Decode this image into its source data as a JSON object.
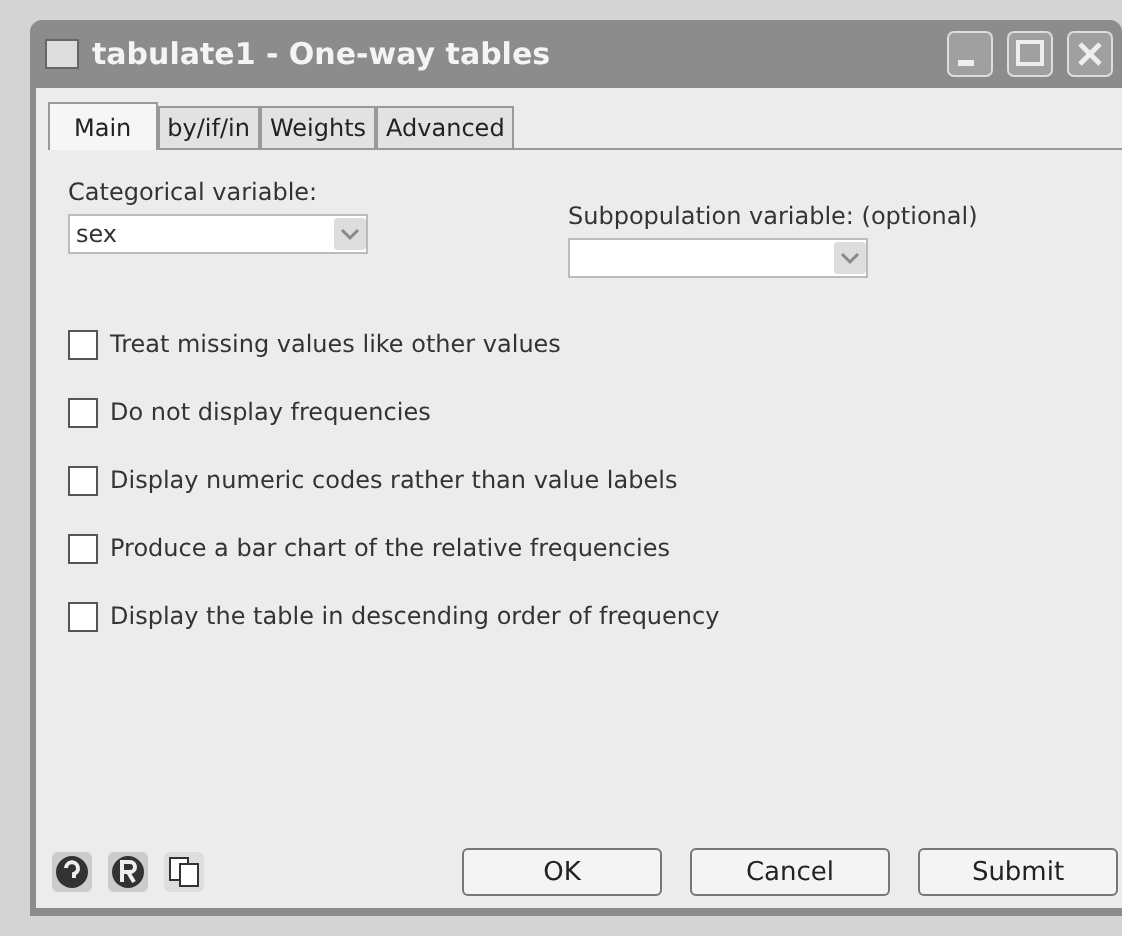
{
  "window": {
    "title": "tabulate1 - One-way tables"
  },
  "tabs": [
    {
      "label": "Main",
      "selected": true
    },
    {
      "label": "by/if/in",
      "selected": false
    },
    {
      "label": "Weights",
      "selected": false
    },
    {
      "label": "Advanced",
      "selected": false
    }
  ],
  "fields": [
    {
      "label": "Categorical variable:",
      "value": "sex"
    },
    {
      "label": "Subpopulation variable: (optional)"
    }
  ],
  "options": [
    {
      "label": "Treat missing values like other values",
      "checked": false
    },
    {
      "label": "Do not display frequencies",
      "checked": false
    },
    {
      "label": "Display numeric codes rather than value labels",
      "checked": false
    },
    {
      "label": "Produce a bar chart of the relative frequencies",
      "checked": false
    },
    {
      "label": "Display the table in descending order of frequency",
      "checked": false
    }
  ],
  "buttons": [
    "OK",
    "Cancel",
    "Submit"
  ]
}
